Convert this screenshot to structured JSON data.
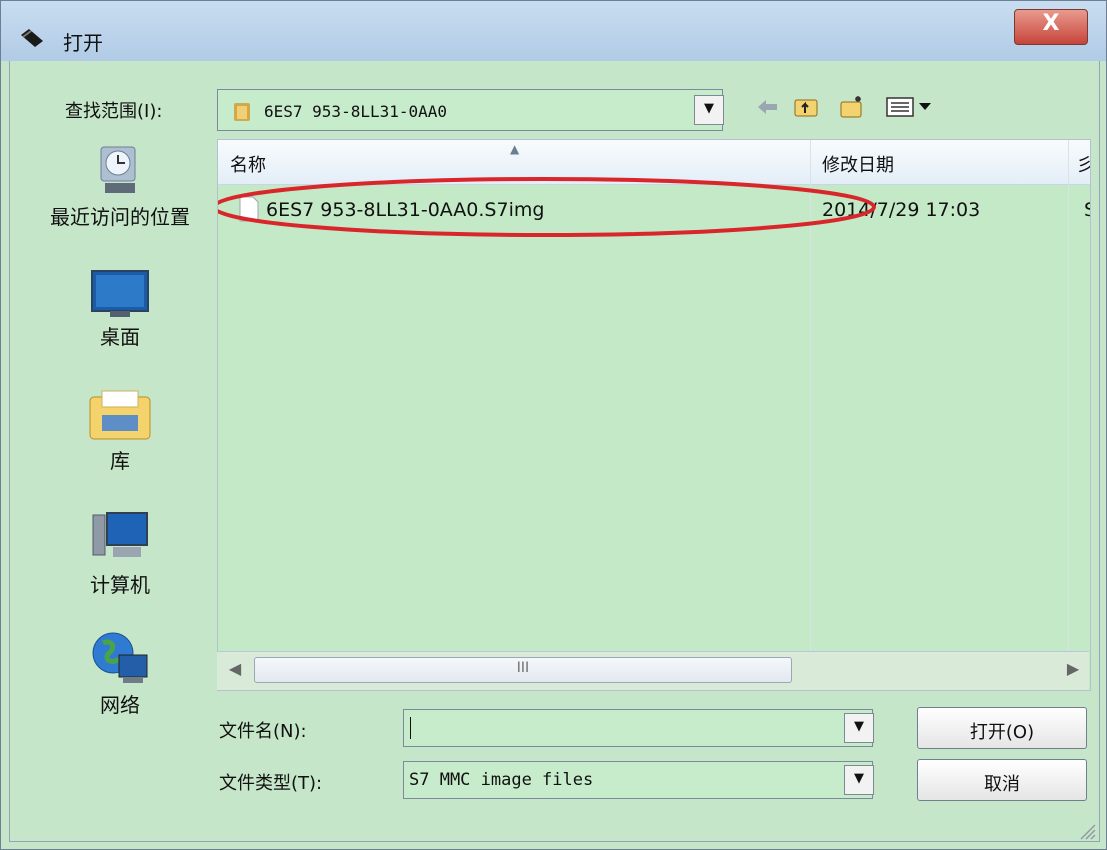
{
  "window": {
    "title": "打开",
    "close_label": "X"
  },
  "look_in": {
    "label": "查找范围(I):",
    "value": "6ES7 953-8LL31-0AA0"
  },
  "toolbar": {
    "icons": [
      "back-arrow-icon",
      "up-folder-icon",
      "new-folder-icon",
      "view-menu-icon"
    ]
  },
  "places": [
    {
      "label": "最近访问的位置",
      "icon": "recent-places-icon"
    },
    {
      "label": "桌面",
      "icon": "desktop-icon"
    },
    {
      "label": "库",
      "icon": "libraries-icon"
    },
    {
      "label": "计算机",
      "icon": "computer-icon"
    },
    {
      "label": "网络",
      "icon": "network-icon"
    }
  ],
  "file_list": {
    "columns": [
      "名称",
      "修改日期",
      "彡"
    ],
    "rows": [
      {
        "name": "6ES7 953-8LL31-0AA0.S7img",
        "date": "2014/7/29 17:03",
        "extra": "S"
      }
    ]
  },
  "scrollbar": {
    "thumb_label": "III"
  },
  "filename": {
    "label": "文件名(N):",
    "value": ""
  },
  "filetype": {
    "label": "文件类型(T):",
    "value": "S7 MMC image files"
  },
  "buttons": {
    "open": "打开(O)",
    "cancel": "取消"
  },
  "colors": {
    "background": "#c7e9cb",
    "annotation": "#d8262b",
    "close_button": "#c7443a"
  }
}
